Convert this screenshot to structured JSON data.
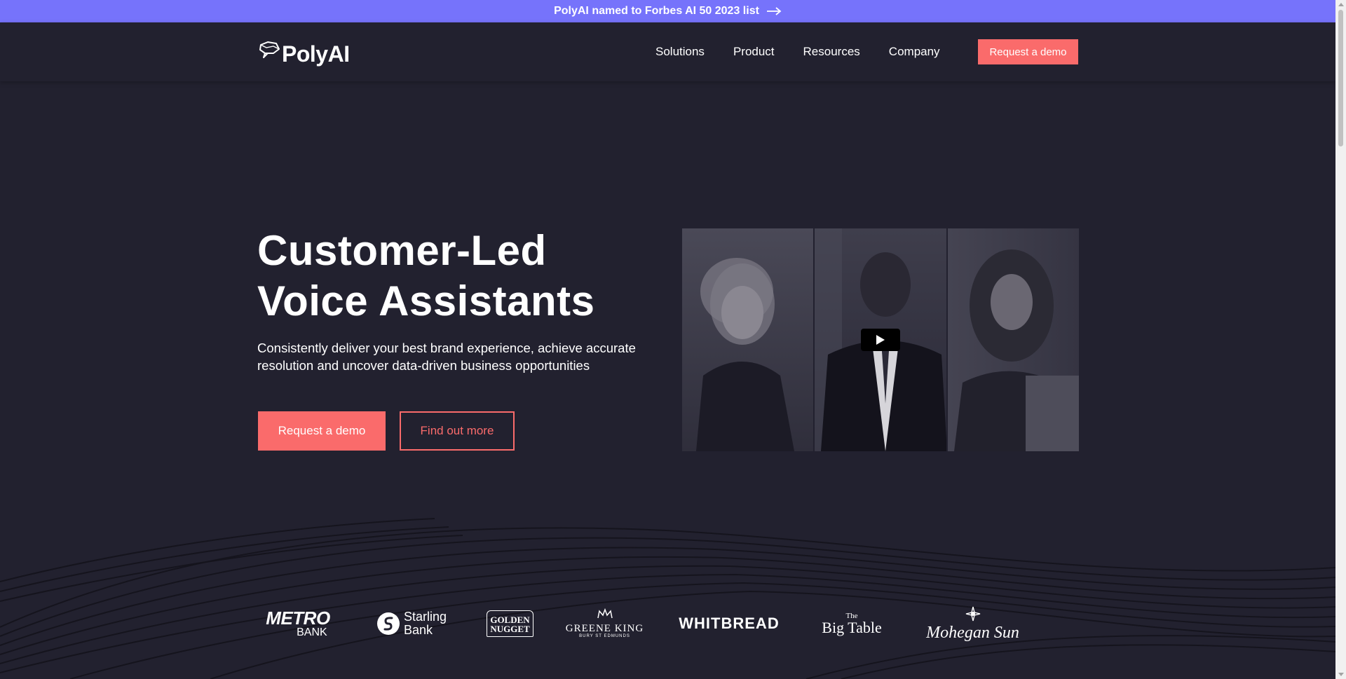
{
  "announcement": {
    "text": "PolyAI named to Forbes AI 50 2023 list",
    "icon": "arrow-right-icon"
  },
  "header": {
    "logo_text": "PolyAI",
    "nav": [
      {
        "label": "Solutions"
      },
      {
        "label": "Product"
      },
      {
        "label": "Resources"
      },
      {
        "label": "Company"
      }
    ],
    "cta_label": "Request a demo"
  },
  "hero": {
    "title_line1": "Customer-Led",
    "title_line2": "Voice Assistants",
    "subtitle": "Consistently deliver your best brand experience, achieve accurate resolution and uncover data-driven business opportunities",
    "primary_label": "Request a demo",
    "secondary_label": "Find out more"
  },
  "video": {
    "play_icon": "play-icon"
  },
  "logos": [
    {
      "name": "metro-bank",
      "line1": "METRO",
      "line2": "BANK"
    },
    {
      "name": "starling-bank",
      "line1": "Starling",
      "line2": "Bank"
    },
    {
      "name": "golden-nugget",
      "line1": "GOLDEN",
      "line2": "NUGGET"
    },
    {
      "name": "greene-king",
      "line1": "GREENE KING",
      "line2": "BURY ST EDMUNDS"
    },
    {
      "name": "whitbread",
      "line1": "WHITBREAD"
    },
    {
      "name": "the-big-table",
      "line1": "The",
      "line2": "Big Table"
    },
    {
      "name": "mohegan-sun",
      "line1": "Mohegan Sun"
    }
  ],
  "colors": {
    "accent": "#fa6b6b",
    "announce_bg": "#7673fb",
    "page_bg": "#22212f"
  }
}
